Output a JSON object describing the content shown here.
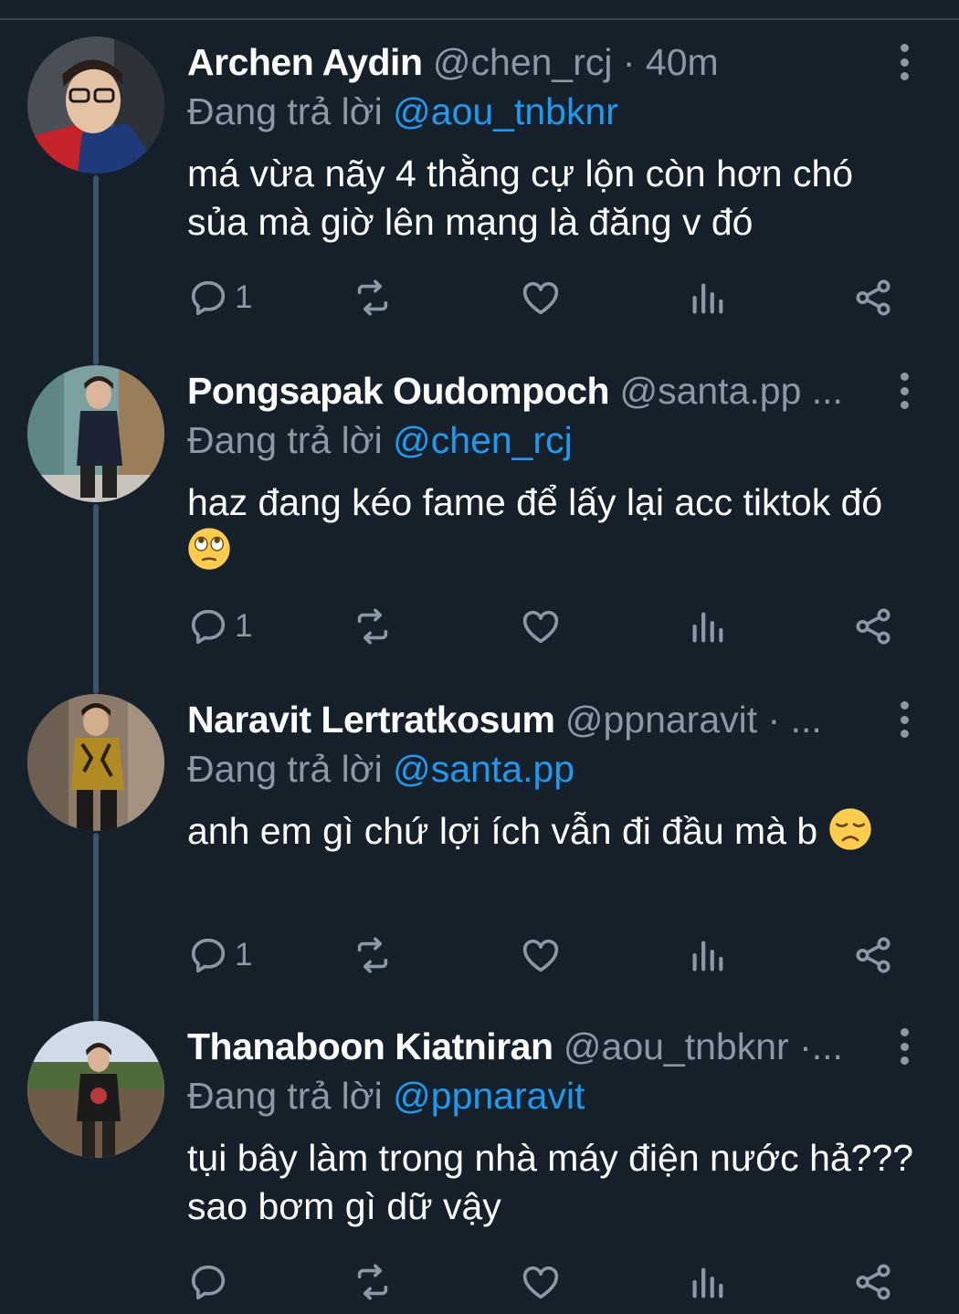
{
  "colors": {
    "background": "#15202b",
    "secondary_text": "#8b98a5",
    "link": "#1d9bf0",
    "thread_line": "#3d5466"
  },
  "tweets": [
    {
      "name": "Archen Aydin",
      "handle_meta": "@chen_rcj · 40m",
      "reply_label": "Đang trả lời",
      "reply_target": "@aou_tnbknr",
      "text": "má vừa nãy 4 thằng cự lộn còn hơn chó sủa mà giờ lên mạng là đăng v đó",
      "emoji": null,
      "reply_count": "1"
    },
    {
      "name": "Pongsapak Oudompoch",
      "handle_meta": "@santa.pp ...",
      "reply_label": "Đang trả lời",
      "reply_target": "@chen_rcj",
      "text": "haz đang kéo fame để lấy lại acc tiktok đó",
      "emoji": "face-with-rolling-eyes",
      "reply_count": "1"
    },
    {
      "name": "Naravit Lertratkosum",
      "handle_meta": "@ppnaravit · ...",
      "reply_label": "Đang trả lời",
      "reply_target": "@santa.pp",
      "text": "anh em gì chứ lợi ích vẫn đi đầu mà b",
      "emoji": "disappointed-face",
      "reply_count": "1"
    },
    {
      "name": "Thanaboon Kiatniran",
      "handle_meta": "@aou_tnbknr ·...",
      "reply_label": "Đang trả lời",
      "reply_target": "@ppnaravit",
      "text": "tụi bây làm trong nhà máy điện nước hả??? sao bơm gì dữ vậy",
      "emoji": null,
      "reply_count": ""
    }
  ],
  "icons": [
    "reply-icon",
    "retweet-icon",
    "like-icon",
    "views-icon",
    "share-icon",
    "more-icon"
  ]
}
